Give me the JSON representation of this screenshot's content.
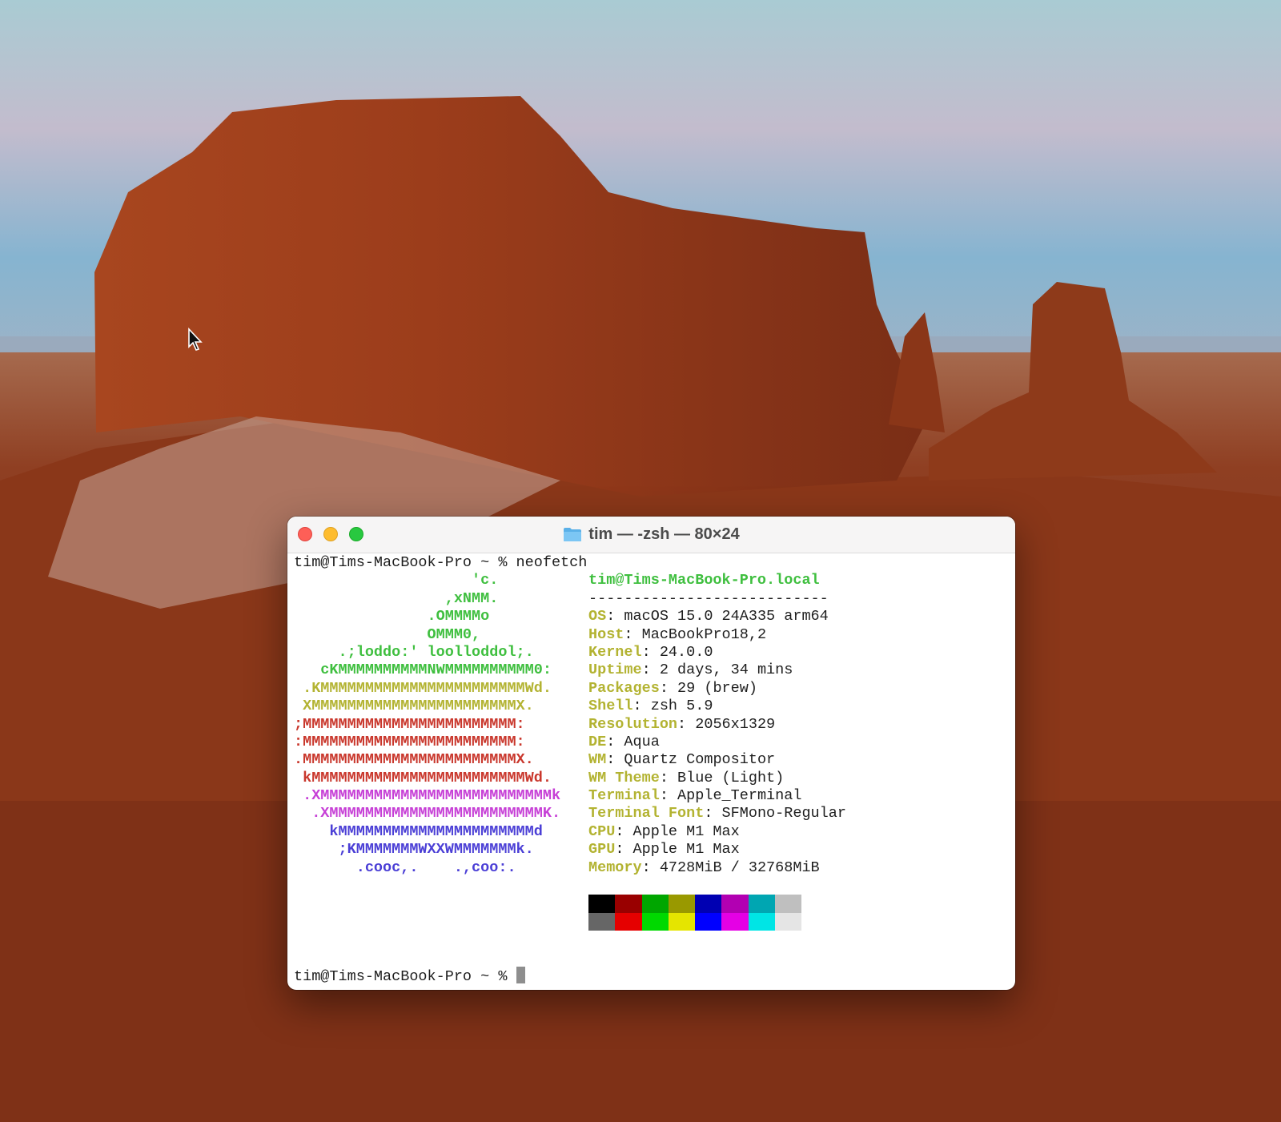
{
  "window": {
    "title": "tim — -zsh — 80×24",
    "icon": "folder-icon"
  },
  "terminal": {
    "command_line": "tim@Tims-MacBook-Pro ~ % neofetch",
    "prompt": "tim@Tims-MacBook-Pro ~ % ",
    "userhost": "tim@Tims-MacBook-Pro.local",
    "separator": "---------------------------",
    "logo": [
      {
        "text": "                    'c.",
        "color": "#3fbf3f"
      },
      {
        "text": "                 ,xNMM.",
        "color": "#3fbf3f"
      },
      {
        "text": "               .OMMMMo",
        "color": "#3fbf3f"
      },
      {
        "text": "               OMMM0,",
        "color": "#3fbf3f"
      },
      {
        "text": "     .;loddo:' loolloddol;.",
        "color": "#3fbf3f"
      },
      {
        "text": "   cKMMMMMMMMMMNWMMMMMMMMMM0:",
        "color": "#3fbf3f"
      },
      {
        "text": " .KMMMMMMMMMMMMMMMMMMMMMMMWd.",
        "color": "#b3b332"
      },
      {
        "text": " XMMMMMMMMMMMMMMMMMMMMMMMX.",
        "color": "#b3b332"
      },
      {
        "text": ";MMMMMMMMMMMMMMMMMMMMMMMM:",
        "color": "#c9372c"
      },
      {
        "text": ":MMMMMMMMMMMMMMMMMMMMMMMM:",
        "color": "#c9372c"
      },
      {
        "text": ".MMMMMMMMMMMMMMMMMMMMMMMMX.",
        "color": "#c9372c"
      },
      {
        "text": " kMMMMMMMMMMMMMMMMMMMMMMMMWd.",
        "color": "#c9372c"
      },
      {
        "text": " .XMMMMMMMMMMMMMMMMMMMMMMMMMMk",
        "color": "#c63fd6"
      },
      {
        "text": "  .XMMMMMMMMMMMMMMMMMMMMMMMMK.",
        "color": "#c63fd6"
      },
      {
        "text": "    kMMMMMMMMMMMMMMMMMMMMMMd",
        "color": "#4b3fd6"
      },
      {
        "text": "     ;KMMMMMMMWXXWMMMMMMMk.",
        "color": "#4b3fd6"
      },
      {
        "text": "       .cooc,.    .,coo:.",
        "color": "#4b3fd6"
      }
    ],
    "info": [
      {
        "label": "OS",
        "value": ": macOS 15.0 24A335 arm64"
      },
      {
        "label": "Host",
        "value": ": MacBookPro18,2"
      },
      {
        "label": "Kernel",
        "value": ": 24.0.0"
      },
      {
        "label": "Uptime",
        "value": ": 2 days, 34 mins"
      },
      {
        "label": "Packages",
        "value": ": 29 (brew)"
      },
      {
        "label": "Shell",
        "value": ": zsh 5.9"
      },
      {
        "label": "Resolution",
        "value": ": 2056x1329"
      },
      {
        "label": "DE",
        "value": ": Aqua"
      },
      {
        "label": "WM",
        "value": ": Quartz Compositor"
      },
      {
        "label": "WM Theme",
        "value": ": Blue (Light)"
      },
      {
        "label": "Terminal",
        "value": ": Apple_Terminal"
      },
      {
        "label": "Terminal Font",
        "value": ": SFMono-Regular"
      },
      {
        "label": "CPU",
        "value": ": Apple M1 Max"
      },
      {
        "label": "GPU",
        "value": ": Apple M1 Max"
      },
      {
        "label": "Memory",
        "value": ": 4728MiB / 32768MiB"
      }
    ],
    "palette_normal": [
      "#000000",
      "#990000",
      "#00a600",
      "#999900",
      "#0000b2",
      "#b200b2",
      "#00a6b2",
      "#bfbfbf"
    ],
    "palette_bright": [
      "#666666",
      "#e50000",
      "#00d900",
      "#e5e500",
      "#0000ff",
      "#e500e5",
      "#00e5e5",
      "#e5e5e5"
    ]
  }
}
